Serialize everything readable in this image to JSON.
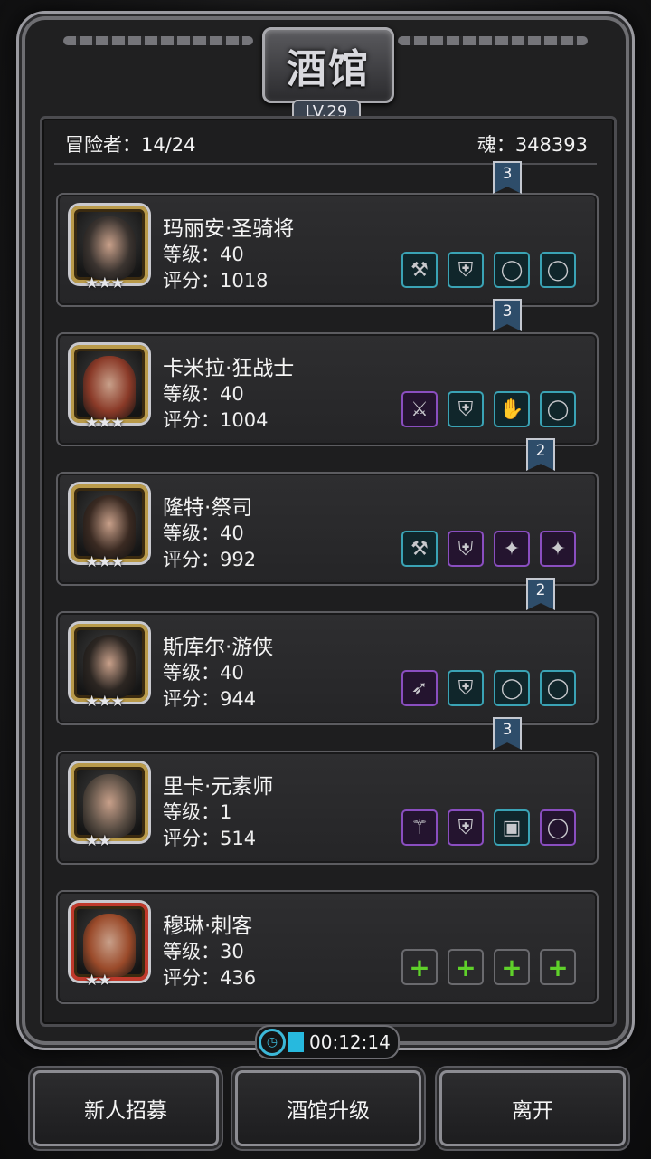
{
  "title": "酒馆",
  "level": "LV.29",
  "adventurers": "冒险者：14/24",
  "souls": "魂：348393",
  "heroes": [
    {
      "name": "玛丽安·圣骑将",
      "level": "等级：40",
      "score": "评分：1018",
      "stars": "★★★",
      "rank": "3",
      "portrait_color": "#3b3430",
      "frame_color": "#b99a4a",
      "equip": [
        {
          "icon": "hammer-icon",
          "glyph": "⚒",
          "tier": "teal"
        },
        {
          "icon": "armor-icon",
          "glyph": "⛨",
          "tier": "teal"
        },
        {
          "icon": "ring-icon",
          "glyph": "◯",
          "tier": "teal"
        },
        {
          "icon": "ring-icon",
          "glyph": "◯",
          "tier": "teal"
        }
      ]
    },
    {
      "name": "卡米拉·狂战士",
      "level": "等级：40",
      "score": "评分：1004",
      "stars": "★★★",
      "rank": "3",
      "portrait_color": "#8a3a28",
      "frame_color": "#b99a4a",
      "equip": [
        {
          "icon": "axe-icon",
          "glyph": "⚔",
          "tier": "purple"
        },
        {
          "icon": "armor-icon",
          "glyph": "⛨",
          "tier": "teal"
        },
        {
          "icon": "gauntlet-icon",
          "glyph": "✋",
          "tier": "teal"
        },
        {
          "icon": "ring-icon",
          "glyph": "◯",
          "tier": "teal"
        }
      ]
    },
    {
      "name": "隆特·祭司",
      "level": "等级：40",
      "score": "评分：992",
      "stars": "★★★",
      "rank": "2",
      "portrait_color": "#3a2a22",
      "frame_color": "#b99a4a",
      "equip": [
        {
          "icon": "hammer-icon",
          "glyph": "⚒",
          "tier": "teal"
        },
        {
          "icon": "armor-icon",
          "glyph": "⛨",
          "tier": "purple"
        },
        {
          "icon": "amulet-icon",
          "glyph": "✦",
          "tier": "purple"
        },
        {
          "icon": "amulet-icon",
          "glyph": "✦",
          "tier": "purple"
        }
      ]
    },
    {
      "name": "斯库尔·游侠",
      "level": "等级：40",
      "score": "评分：944",
      "stars": "★★★",
      "rank": "2",
      "portrait_color": "#2c2622",
      "frame_color": "#b99a4a",
      "equip": [
        {
          "icon": "crossbow-icon",
          "glyph": "➶",
          "tier": "purple"
        },
        {
          "icon": "armor-icon",
          "glyph": "⛨",
          "tier": "teal"
        },
        {
          "icon": "ring-icon",
          "glyph": "◯",
          "tier": "teal"
        },
        {
          "icon": "ring-icon",
          "glyph": "◯",
          "tier": "teal"
        }
      ]
    },
    {
      "name": "里卡·元素师",
      "level": "等级：1",
      "score": "评分：514",
      "stars": "★★",
      "rank": "3",
      "portrait_color": "#5a4e44",
      "frame_color": "#b99a4a",
      "equip": [
        {
          "icon": "staff-icon",
          "glyph": "⚚",
          "tier": "purple"
        },
        {
          "icon": "cloak-icon",
          "glyph": "⛨",
          "tier": "purple"
        },
        {
          "icon": "chest-icon",
          "glyph": "▣",
          "tier": "teal"
        },
        {
          "icon": "ring-icon",
          "glyph": "◯",
          "tier": "purple"
        }
      ]
    },
    {
      "name": "穆琳·刺客",
      "level": "等级：30",
      "score": "评分：436",
      "stars": "★★",
      "rank": "",
      "portrait_color": "#9a4a2a",
      "frame_color": "#c0392b",
      "equip": [
        {
          "icon": "add-weapon-icon",
          "glyph": "+",
          "tier": "add"
        },
        {
          "icon": "add-armor-icon",
          "glyph": "+",
          "tier": "add"
        },
        {
          "icon": "add-ring-icon",
          "glyph": "+",
          "tier": "add"
        },
        {
          "icon": "add-ring-icon",
          "glyph": "+",
          "tier": "add"
        }
      ]
    }
  ],
  "timer": "00:12:14",
  "buttons": {
    "recruit": "新人招募",
    "upgrade": "酒馆升级",
    "leave": "离开"
  }
}
